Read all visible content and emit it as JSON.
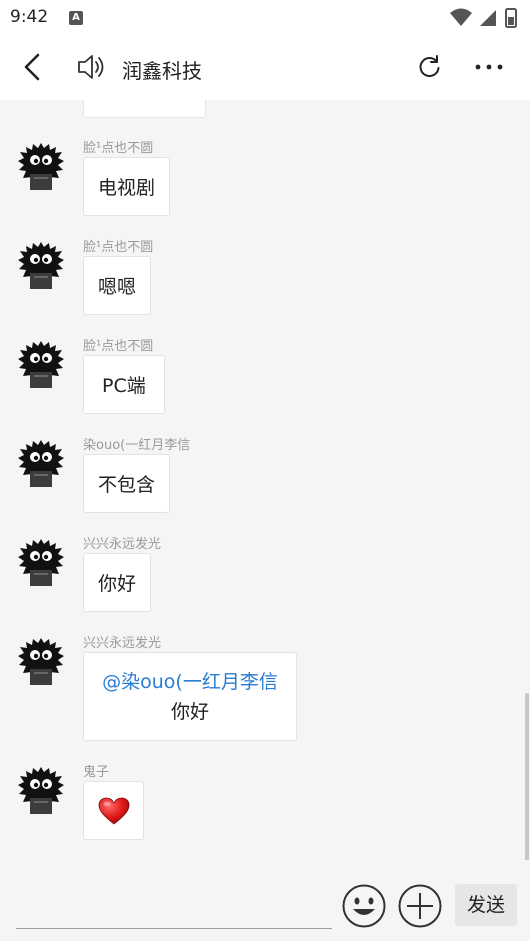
{
  "status_bar": {
    "time": "9:42",
    "badge": "A"
  },
  "header": {
    "title": "润鑫科技"
  },
  "messages": [
    {
      "sender": "脸¹点也不圆",
      "text": "电视剧"
    },
    {
      "sender": "脸¹点也不圆",
      "text": "嗯嗯"
    },
    {
      "sender": "脸¹点也不圆",
      "text": "PC端"
    },
    {
      "sender": "染ouo(一红月李信",
      "text": "不包含"
    },
    {
      "sender": "兴兴永远发光",
      "text": "你好"
    },
    {
      "sender": "兴兴永远发光",
      "mention": "@染ouo(一红月李信",
      "text": "你好"
    },
    {
      "sender": "鬼子",
      "emoji": "heart"
    }
  ],
  "input_bar": {
    "send_label": "发送"
  },
  "colors": {
    "mention": "#2a7bd4",
    "sender": "#9a9a9a",
    "background": "#f5f5f5"
  }
}
